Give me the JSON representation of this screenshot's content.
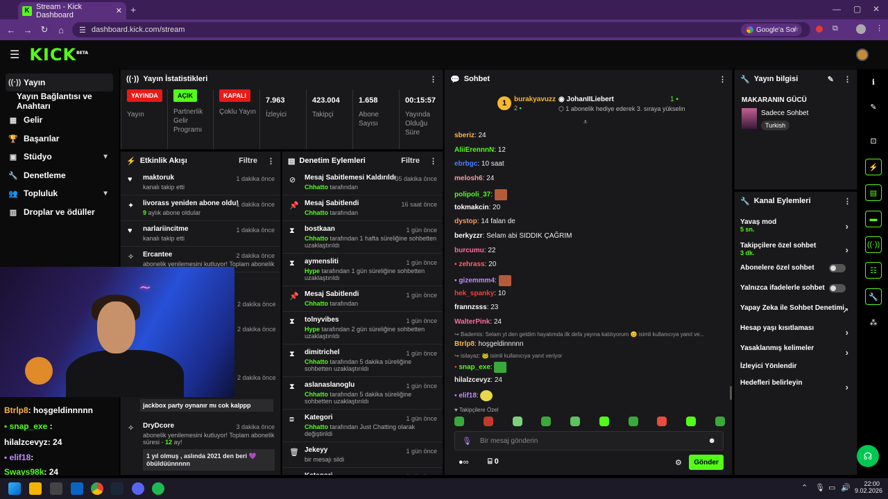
{
  "browser": {
    "tab_title": "Stream - Kick Dashboard",
    "url": "dashboard.kick.com/stream",
    "google_btn": "Google'a Sor"
  },
  "header": {
    "logo": "KICK",
    "logo_tag": "BETA"
  },
  "nav": {
    "items": [
      {
        "label": "Yayın",
        "icon": "broadcast-icon"
      },
      {
        "label": "Yayın Bağlantısı ve Anahtarı",
        "icon": ""
      },
      {
        "label": "Gelir",
        "icon": "revenue-icon"
      },
      {
        "label": "Başarılar",
        "icon": "trophy-icon"
      },
      {
        "label": "Stüdyo",
        "icon": "studio-icon"
      },
      {
        "label": "Denetleme",
        "icon": "wrench-icon"
      },
      {
        "label": "Topluluk",
        "icon": "community-icon"
      },
      {
        "label": "Droplar ve ödüller",
        "icon": "drops-icon"
      }
    ]
  },
  "overlay_chat": [
    {
      "user": "Btrlp8",
      "text": ": hoşgeldinnnnn",
      "color": "#ffb347"
    },
    {
      "user": "snap_exe",
      "text": " :",
      "color": "#53fc18"
    },
    {
      "user": "hilalzcevyz",
      "text": ": 24",
      "color": "#ffffff"
    },
    {
      "user": "elif18",
      "text": ":",
      "color": "#c48bff"
    },
    {
      "user": "Sways98k",
      "text": ": 24",
      "color": "#53fc18"
    }
  ],
  "stats": {
    "title": "Yayın İstatistikleri",
    "live_badge": "YAYINDA",
    "live_label": "Yayın",
    "partner_badge": "AÇIK",
    "partner_label": "Partnerlik Gelir Programı",
    "multi_badge": "KAPALI",
    "multi_label": "Çoklu Yayın",
    "viewers": "7.963",
    "viewers_label": "İzleyici",
    "followers": "423.004",
    "followers_label": "Takipçi",
    "subs": "1.658",
    "subs_label": "Abone Sayısı",
    "uptime": "00:15:57",
    "uptime_label": "Yayında Olduğu Süre"
  },
  "activity": {
    "title": "Etkinlik Akışı",
    "filter": "Filtre",
    "items": [
      {
        "title": "maktoruk",
        "sub": "kanalı takip etti",
        "when": "1 dakika önce"
      },
      {
        "title": "livorass yeniden abone oldu!",
        "sub_num": "9",
        "sub": " aylık abone oldular",
        "when": "1 dakika önce"
      },
      {
        "title": "narlariincitme",
        "sub": "kanalı takip etti",
        "when": "1 dakika önce"
      },
      {
        "title": "Ercantee",
        "sub": "abonelik yenilemesini kutluyor! Toplam abonelik",
        "when": "2 dakika önce"
      },
      {
        "title": "",
        "sub": "",
        "when": "2 dakika önce"
      },
      {
        "title": "",
        "sub": "tlam abonelik",
        "when": "2 dakika önce"
      },
      {
        "title": "",
        "sub": "tlam abonelik",
        "when": "2 dakika önce"
      },
      {
        "quote": "jackbox party oynanır mı cok kalppp"
      },
      {
        "title": "DryDcore",
        "sub": "abonelik yenilemesini kutluyor! Toplam abonelik süresi - ",
        "sub_num": "12",
        "sub_end": " ay!",
        "when": "3 dakika önce",
        "quote": "1 yıl olmuş , aslında 2021 den beri 💜 öbüldüünnnnn"
      }
    ]
  },
  "moderation": {
    "title": "Denetim Eylemleri",
    "filter": "Filtre",
    "items": [
      {
        "title": "Mesaj Sabitlemesi Kaldırıldı",
        "actor": "Chhatto",
        "sub": " tarafından",
        "when": "35 dakika önce"
      },
      {
        "title": "Mesaj Sabitlendi",
        "actor": "Chhatto",
        "sub": " tarafından",
        "when": "16 saat önce"
      },
      {
        "title": "bostkaan",
        "actor": "Chhatto",
        "sub": " tarafından 1 hafta süreliğine sohbetten uzaklaştırıldı",
        "when": "1 gün önce"
      },
      {
        "title": "aymensliti",
        "actor": "Hype",
        "sub": " tarafından 1 gün süreliğine sohbetten uzaklaştırıldı",
        "when": "1 gün önce"
      },
      {
        "title": "Mesaj Sabitlendi",
        "actor": "Chhatto",
        "sub": " tarafından",
        "when": "1 gün önce"
      },
      {
        "title": "tolnyvibes",
        "actor": "Hype",
        "sub": " tarafından 2 gün süreliğine sohbetten uzaklaştırıldı",
        "when": "1 gün önce"
      },
      {
        "title": "dimitrichel",
        "actor": "Chhatto",
        "sub": " tarafından 5 dakika süreliğine sohbetten uzaklaştırıldı",
        "when": "1 gün önce"
      },
      {
        "title": "aslanaslanoglu",
        "actor": "Chhatto",
        "sub": " tarafından 5 dakika süreliğine sohbetten uzaklaştırıldı",
        "when": "1 gün önce"
      },
      {
        "title": "Kategori",
        "actor": "Chhatto",
        "sub": " tarafından Just Chatting olarak değiştirildi",
        "when": "1 gün önce"
      },
      {
        "title": "Jekeyy",
        "actor": "",
        "sub": "bir mesajı sildi",
        "when": "1 gün önce"
      },
      {
        "title": "Kategori",
        "actor": "",
        "sub": "",
        "when": "1 gün önce"
      }
    ]
  },
  "chat": {
    "title": "Sohbet",
    "top_user": "burakyavuzz",
    "top_count": "2",
    "gift_user": "JohanIILiebert",
    "gift_count": "1",
    "gift_text": "1 abonelik hediye ederek 3. sıraya yükselin",
    "messages": [
      {
        "user": "sberiz",
        "text": ": 24",
        "color": "#ffb347"
      },
      {
        "user": "AliiErennnN",
        "text": ": 12",
        "color": "#53fc18"
      },
      {
        "user": "ebrbgc",
        "text": ": 10 saat",
        "color": "#4a7dff"
      },
      {
        "user": "melosh6",
        "text": ": 24",
        "color": "#ff9a9a"
      },
      {
        "user": "polipoli_37",
        "text": ":",
        "color": "#53fc18"
      },
      {
        "user": "tokmakcin",
        "text": ": 20",
        "color": "#ffffff"
      },
      {
        "user": "dystop",
        "text": ": 14 falan de",
        "color": "#ff9a5a"
      },
      {
        "user": "berkyzzr",
        "text": ": Selam abi SIDDIK ÇAĞRIM",
        "color": "#ffffff"
      },
      {
        "user": "burcumu",
        "text": ": 22",
        "color": "#ff6b9a"
      },
      {
        "user": "zehrass",
        "text": ": 20",
        "color": "#ff6060"
      },
      {
        "user": "gizemmm4",
        "text": ":",
        "color": "#c48bff"
      },
      {
        "user": "hek_spanky",
        "text": ": 10",
        "color": "#ff3b3b"
      },
      {
        "user": "frannzsss",
        "text": ": 23",
        "color": "#ffffff"
      },
      {
        "user": "WalterPink",
        "text": ": 24",
        "color": "#ff6b9a"
      }
    ],
    "reply1": "Bademis: Selam yt den geldim hayatımda ilk defa yayına katılıyorum 😊 isimli kullanıcıya yanıt ve...",
    "reply1_user": "Btrlp8",
    "reply1_text": ": hoşgeldinnnnn",
    "reply2": "isilayaz: 🐸 isimli kullanıcıya yanıt veriyor",
    "reply2_user": "snap_exe",
    "reply2_text": ":",
    "msg_after": [
      {
        "user": "hilalzcevyz",
        "text": ": 24",
        "color": "#ffffff"
      },
      {
        "user": "elif18",
        "text": ":",
        "color": "#c48bff"
      }
    ],
    "followers_only": "Takipçilere Özel",
    "input_placeholder": "Bir mesaj gönderin",
    "points": "0",
    "send": "Gönder"
  },
  "info": {
    "title": "Yayın bilgisi",
    "stream_title": "MAKARANIN GÜCÜ",
    "category": "Sadece Sohbet",
    "tag": "Turkish"
  },
  "channel_actions": {
    "title": "Kanal Eylemleri",
    "items": [
      {
        "label": "Yavaş mod",
        "sub": "5 sn.",
        "type": "arrow"
      },
      {
        "label": "Takipçilere özel sohbet",
        "sub": "3 dk.",
        "type": "arrow"
      },
      {
        "label": "Abonelere özel sohbet",
        "sub": "",
        "type": "toggle"
      },
      {
        "label": "Yalnızca ifadelerle sohbet",
        "sub": "",
        "type": "toggle"
      },
      {
        "label": "Yapay Zeka ile Sohbet Denetimi",
        "sub": "",
        "type": "ext"
      },
      {
        "label": "Hesap yaşı kısıtlaması",
        "sub": "",
        "type": "arrow"
      },
      {
        "label": "Yasaklanmış kelimeler",
        "sub": "",
        "type": "arrow"
      },
      {
        "label": "İzleyici Yönlendir",
        "sub": "",
        "type": "none"
      },
      {
        "label": "Hedefleri belirleyin",
        "sub": "",
        "type": "arrow"
      }
    ]
  },
  "taskbar": {
    "time": "22:00",
    "date": "9.02.2026"
  },
  "colors": {
    "accent": "#53fc18",
    "live": "#e91916",
    "panel": "#19191b"
  }
}
